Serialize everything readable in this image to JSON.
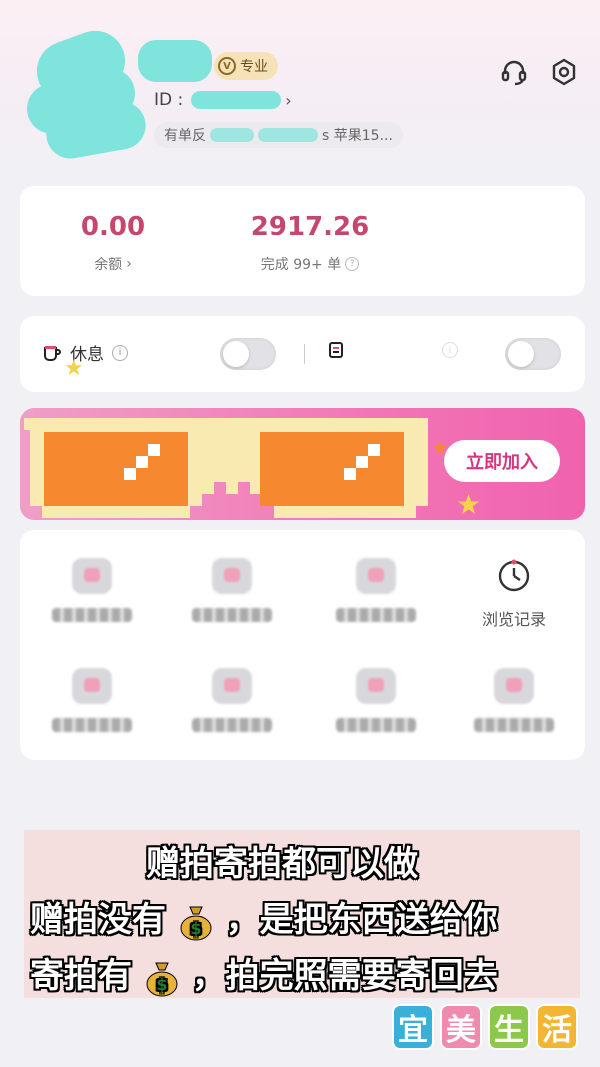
{
  "profile": {
    "level_badge": "专业",
    "level_icon": "V",
    "id_label": "ID :",
    "device_prefix": "有单反",
    "device_suffix": "s 苹果15..."
  },
  "stats": {
    "balance_value": "0.00",
    "balance_label": "余额",
    "completed_value": "2917.26",
    "completed_label": "完成 99+ 单"
  },
  "toggles": {
    "rest_label": "休息"
  },
  "banner": {
    "join_label": "立即加入"
  },
  "grid": {
    "browse_history_label": "浏览记录"
  },
  "caption": {
    "line1": "赠拍寄拍都可以做",
    "line2_prefix": "赠拍没有",
    "line2_suffix": "，是把东西送给你",
    "line3_prefix": "寄拍有",
    "line3_suffix": "，拍完照需要寄回去"
  },
  "watermark": [
    "宜",
    "美",
    "生",
    "活"
  ],
  "colors": {
    "accent": "#c5476e",
    "banner_pink": "#f277b6",
    "mask_teal": "#7fe4dc"
  }
}
